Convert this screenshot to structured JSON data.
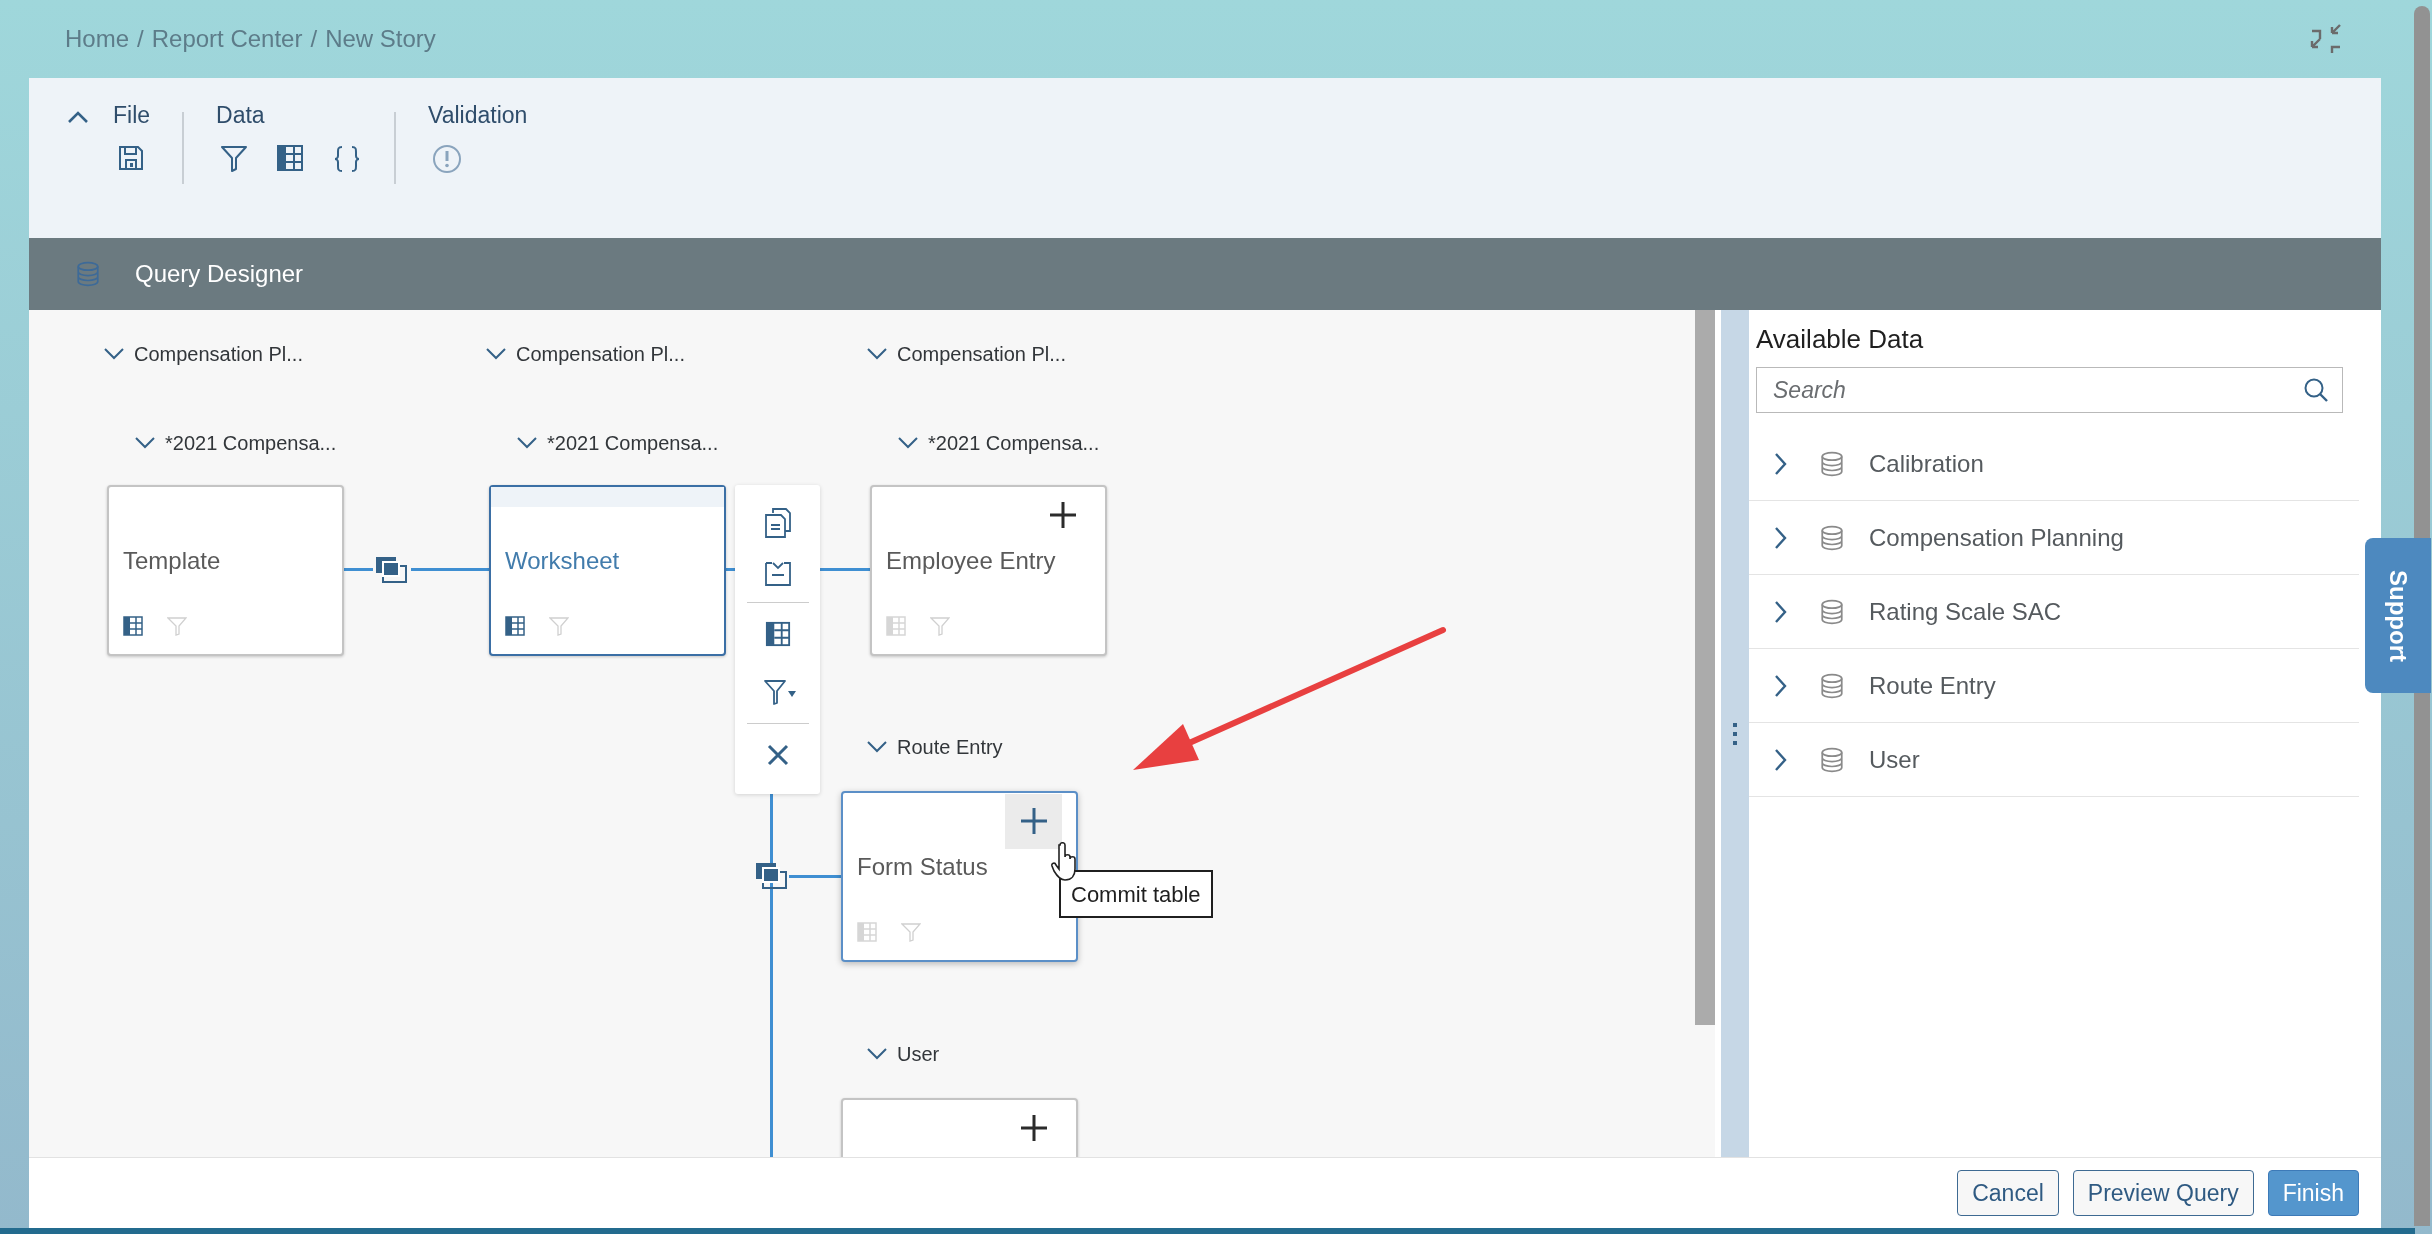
{
  "breadcrumb": {
    "separator": "/",
    "items": [
      "Home",
      "Report Center",
      "New Story"
    ]
  },
  "toolbar": {
    "groups": [
      {
        "label": "File",
        "tools": [
          {
            "kind": "save"
          }
        ]
      },
      {
        "label": "Data",
        "tools": [
          {
            "kind": "filter"
          },
          {
            "kind": "table"
          },
          {
            "kind": "braces"
          }
        ]
      },
      {
        "label": "Validation",
        "tools": [
          {
            "kind": "alert"
          }
        ]
      }
    ]
  },
  "panel_title": "Query Designer",
  "canvas": {
    "nodes": [
      {
        "group": "Compensation Pl...",
        "subgroup": "*2021 Compensa...",
        "title": "Template",
        "selected": false,
        "committed": true,
        "hovered": false
      },
      {
        "group": "Compensation Pl...",
        "subgroup": "*2021 Compensa...",
        "title": "Worksheet",
        "selected": true,
        "committed": true,
        "hovered": false
      },
      {
        "group": "Compensation Pl...",
        "subgroup": "*2021 Compensa...",
        "title": "Employee Entry",
        "selected": false,
        "committed": false,
        "hovered": false
      },
      {
        "group": "Route Entry",
        "title": "Form Status",
        "selected": false,
        "committed": false,
        "hovered": true
      },
      {
        "group": "User",
        "selected": false,
        "committed": false,
        "hovered": false
      }
    ],
    "tooltip": "Commit table"
  },
  "available_data": {
    "title": "Available Data",
    "search": {
      "placeholder": "Search"
    },
    "items": [
      {
        "label": "Calibration",
        "expanded": false
      },
      {
        "label": "Compensation Planning",
        "expanded": false
      },
      {
        "label": "Rating Scale SAC",
        "expanded": false
      },
      {
        "label": "Route Entry",
        "expanded": false
      },
      {
        "label": "User",
        "expanded": false
      }
    ]
  },
  "buttons": [
    {
      "label": "Cancel",
      "kind": "secondary"
    },
    {
      "label": "Preview Query",
      "kind": "secondary"
    },
    {
      "label": "Finish",
      "kind": "primary"
    }
  ],
  "support_tab": "Support"
}
